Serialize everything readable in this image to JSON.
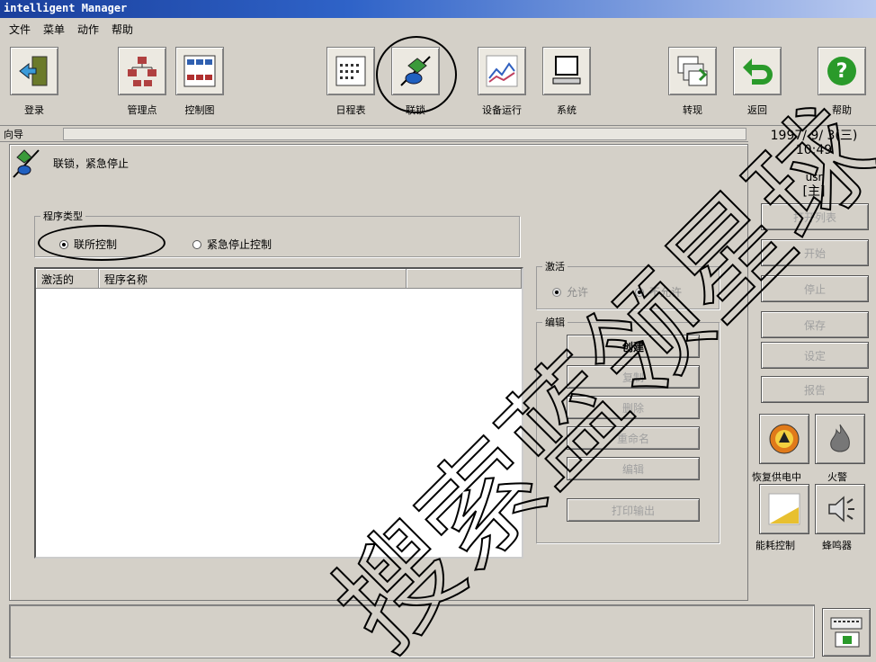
{
  "window": {
    "title": "intelligent Manager"
  },
  "menu": [
    "文件",
    "菜单",
    "动作",
    "帮助"
  ],
  "toolbar": [
    {
      "label": "登录",
      "icon": "door-exit-icon"
    },
    {
      "label": "管理点",
      "icon": "hierarchy-icon"
    },
    {
      "label": "控制图",
      "icon": "control-diagram-icon"
    },
    {
      "label": "日程表",
      "icon": "calendar-icon"
    },
    {
      "label": "联锁",
      "icon": "interlock-icon"
    },
    {
      "label": "设备运行",
      "icon": "trend-chart-icon"
    },
    {
      "label": "系统",
      "icon": "computer-icon"
    },
    {
      "label": "转现",
      "icon": "windows-icon"
    },
    {
      "label": "返回",
      "icon": "back-arrow-icon"
    },
    {
      "label": "帮助",
      "icon": "help-icon"
    }
  ],
  "nav": {
    "label": "向导"
  },
  "datetime": {
    "date": "1997/ 9/ 3(三)",
    "time": "10:49",
    "user": "usr",
    "role": "[主]"
  },
  "page": {
    "title": "联锁，紧急停止"
  },
  "program_type": {
    "title": "程序类型",
    "options": [
      {
        "label": "联所控制",
        "selected": true
      },
      {
        "label": "紧急停止控制",
        "selected": false
      }
    ]
  },
  "list": {
    "headers": [
      "激活的",
      "程序名称"
    ]
  },
  "activate": {
    "title": "激活",
    "options": [
      {
        "label": "允许"
      },
      {
        "label": "不允许"
      }
    ]
  },
  "edit": {
    "title": "编辑",
    "buttons": [
      "创建",
      "复制",
      "删除",
      "重命名",
      "编辑",
      "打印输出"
    ]
  },
  "side_buttons": [
    "打开列表",
    "开始",
    "停止",
    "保存",
    "设定",
    "报告"
  ],
  "quick_icons": [
    {
      "label": "恢复供电中",
      "icon": "power-restore-icon"
    },
    {
      "label": "火警",
      "icon": "fire-icon"
    },
    {
      "label": "能耗控制",
      "icon": "energy-control-icon"
    },
    {
      "label": "蜂鸣器",
      "icon": "buzzer-icon"
    }
  ],
  "watermark": {
    "text": "搜索蓝领星球"
  }
}
